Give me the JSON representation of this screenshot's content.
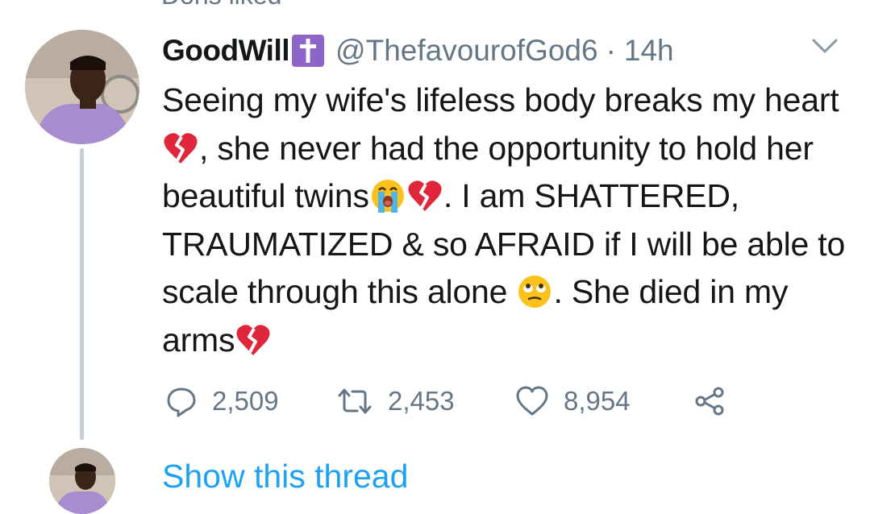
{
  "social_context": {
    "text": "Doris liked"
  },
  "tweet": {
    "author_name": "GoodWill",
    "handle": "@ThefavourofGod6",
    "separator": "·",
    "time": "14h",
    "text_segments": [
      "Seeing my wife's lifeless body breaks my heart",
      ", she never had the opportunity to hold her beautiful twins",
      ". I am SHATTERED, TRAUMATIZED & so AFRAID if I will be able to scale through this alone ",
      ". She died in my arms"
    ],
    "emojis": [
      "broken-heart-icon",
      "loudly-crying-face-icon",
      "broken-heart-icon",
      "face-with-rolling-eyes-icon",
      "broken-heart-icon"
    ],
    "replies": "2,509",
    "retweets": "2,453",
    "likes": "8,954"
  },
  "show_thread": "Show this thread",
  "colors": {
    "text": "#14171a",
    "secondary": "#657786",
    "link": "#1da1f2",
    "thread_line": "#c4cfd6",
    "badge": "#8d64c8",
    "broken_heart": "#e0263a"
  }
}
